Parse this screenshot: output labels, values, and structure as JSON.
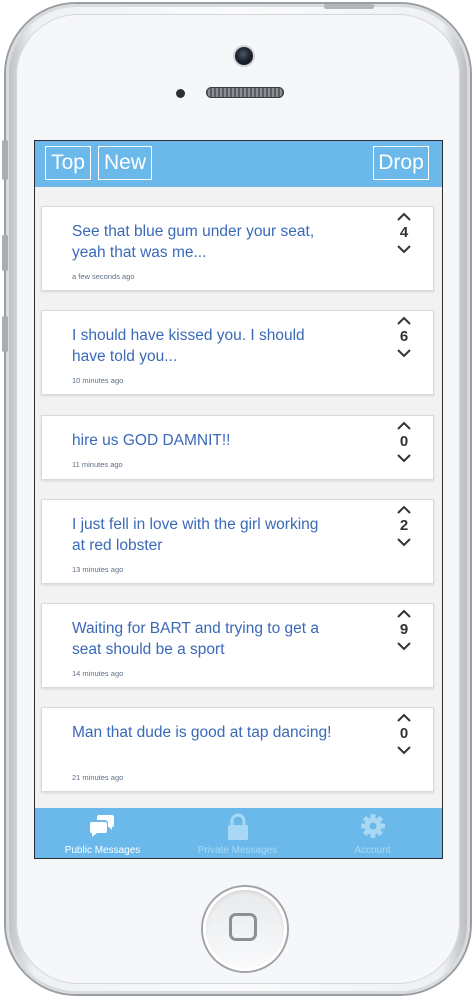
{
  "header": {
    "tabs": [
      {
        "label": "Top"
      },
      {
        "label": "New"
      }
    ],
    "drop_label": "Drop"
  },
  "posts": [
    {
      "text": "See that blue gum under your seat, yeah that was me...",
      "time": "a few seconds ago",
      "votes": "4"
    },
    {
      "text": "I should have kissed you. I should have told you...",
      "time": "10 minutes ago",
      "votes": "6"
    },
    {
      "text": "hire us GOD DAMNIT!!",
      "time": "11 minutes ago",
      "votes": "0"
    },
    {
      "text": "I just fell in love with the girl working at red lobster",
      "time": "13 minutes ago",
      "votes": "2"
    },
    {
      "text": "Waiting for BART and trying to get a seat should be a sport",
      "time": "14 minutes ago",
      "votes": "9"
    },
    {
      "text": "Man that dude is good at tap dancing!",
      "time": "21 minutes ago",
      "votes": "0"
    }
  ],
  "tabbar": {
    "items": [
      {
        "label": "Public Messages",
        "icon": "chat-bubbles-icon",
        "state": "active"
      },
      {
        "label": "Private Messages",
        "icon": "lock-icon",
        "state": "inactive"
      },
      {
        "label": "Account",
        "icon": "gear-icon",
        "state": "inactive"
      }
    ]
  },
  "colors": {
    "accent": "#6ab9ea",
    "message_text": "#3a69b8",
    "inactive_tab_text": "#a9d8f4"
  }
}
